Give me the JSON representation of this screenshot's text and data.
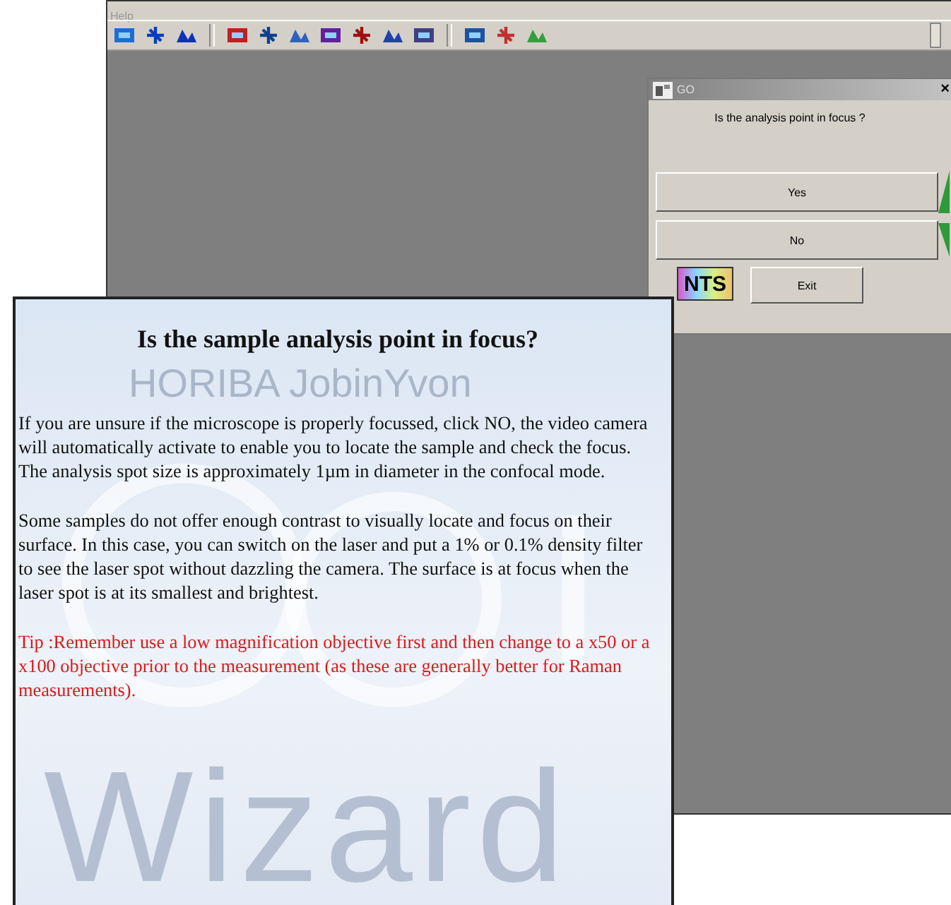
{
  "app": {
    "menu": "Help"
  },
  "dialog": {
    "title": "GO",
    "close": "×",
    "question": "Is the analysis point in focus ?",
    "buttons": [
      {
        "label": "Yes",
        "kind": "up"
      },
      {
        "label": "No",
        "kind": "down"
      }
    ],
    "hints": "NTS",
    "exit": "Exit"
  },
  "help": {
    "title": "Is the sample analysis point in focus?",
    "backdrop": [
      "HORIBA JobinYvon",
      "Wizard"
    ],
    "paragraphs": [
      {
        "kind": "normal",
        "text": "If you are unsure if the microscope is properly focussed, click NO, the video camera will automatically activate to enable you to locate the sample and check the focus. The analysis spot size is approximately 1µm in diameter in the confocal mode."
      },
      {
        "kind": "normal",
        "text": "Some samples do not offer enough contrast to visually locate and focus on their surface. In this case, you can switch on the laser and put a 1% or 0.1% density filter to see the laser spot without dazzling the camera. The surface is at focus when the laser spot is at its smallest and brightest."
      },
      {
        "kind": "tip",
        "text": "Tip :Remember use a low magnification objective first and then change to a x50 or a x100 objective prior to the measurement (as these are generally better for Raman measurements)."
      }
    ]
  }
}
